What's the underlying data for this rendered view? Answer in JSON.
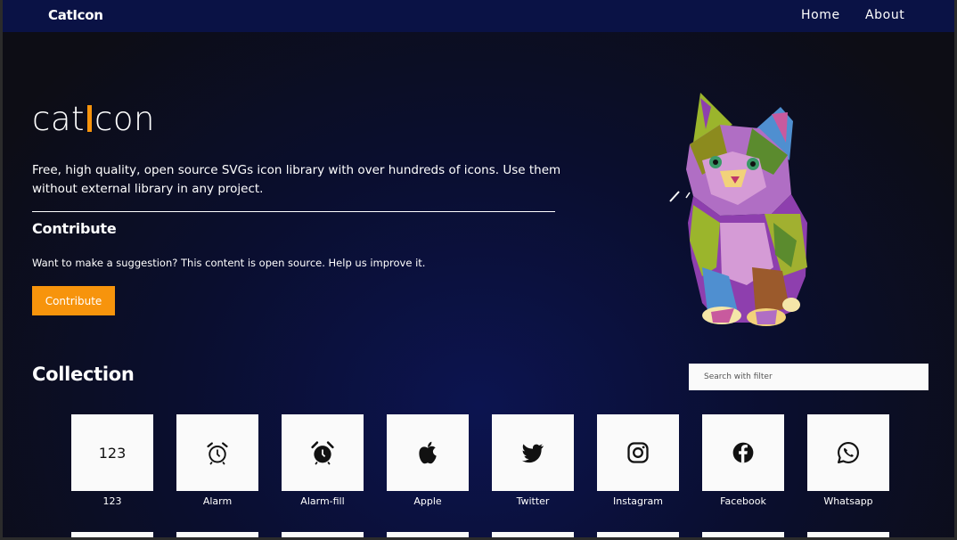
{
  "nav": {
    "brand": "CatIcon",
    "home": "Home",
    "about": "About"
  },
  "hero": {
    "logo_left": "cat",
    "logo_right": "con",
    "tagline": "Free, high quality, open source SVGs icon library with over hundreds of icons. Use them without external library in any project.",
    "contribute_heading": "Contribute",
    "contribute_text": "Want to make a suggestion? This content is open source. Help us improve it.",
    "contribute_button": "Contribute"
  },
  "collection": {
    "title": "Collection",
    "search_placeholder": "Search with filter",
    "icons": [
      {
        "label": "123",
        "icon": "123-icon",
        "text": "123"
      },
      {
        "label": "Alarm",
        "icon": "alarm-icon"
      },
      {
        "label": "Alarm-fill",
        "icon": "alarm-fill-icon"
      },
      {
        "label": "Apple",
        "icon": "apple-icon"
      },
      {
        "label": "Twitter",
        "icon": "twitter-icon"
      },
      {
        "label": "Instagram",
        "icon": "instagram-icon"
      },
      {
        "label": "Facebook",
        "icon": "facebook-icon"
      },
      {
        "label": "Whatsapp",
        "icon": "whatsapp-icon"
      }
    ]
  },
  "colors": {
    "accent": "#f7940c",
    "nav": "#0a1245",
    "card": "#fafafa"
  }
}
